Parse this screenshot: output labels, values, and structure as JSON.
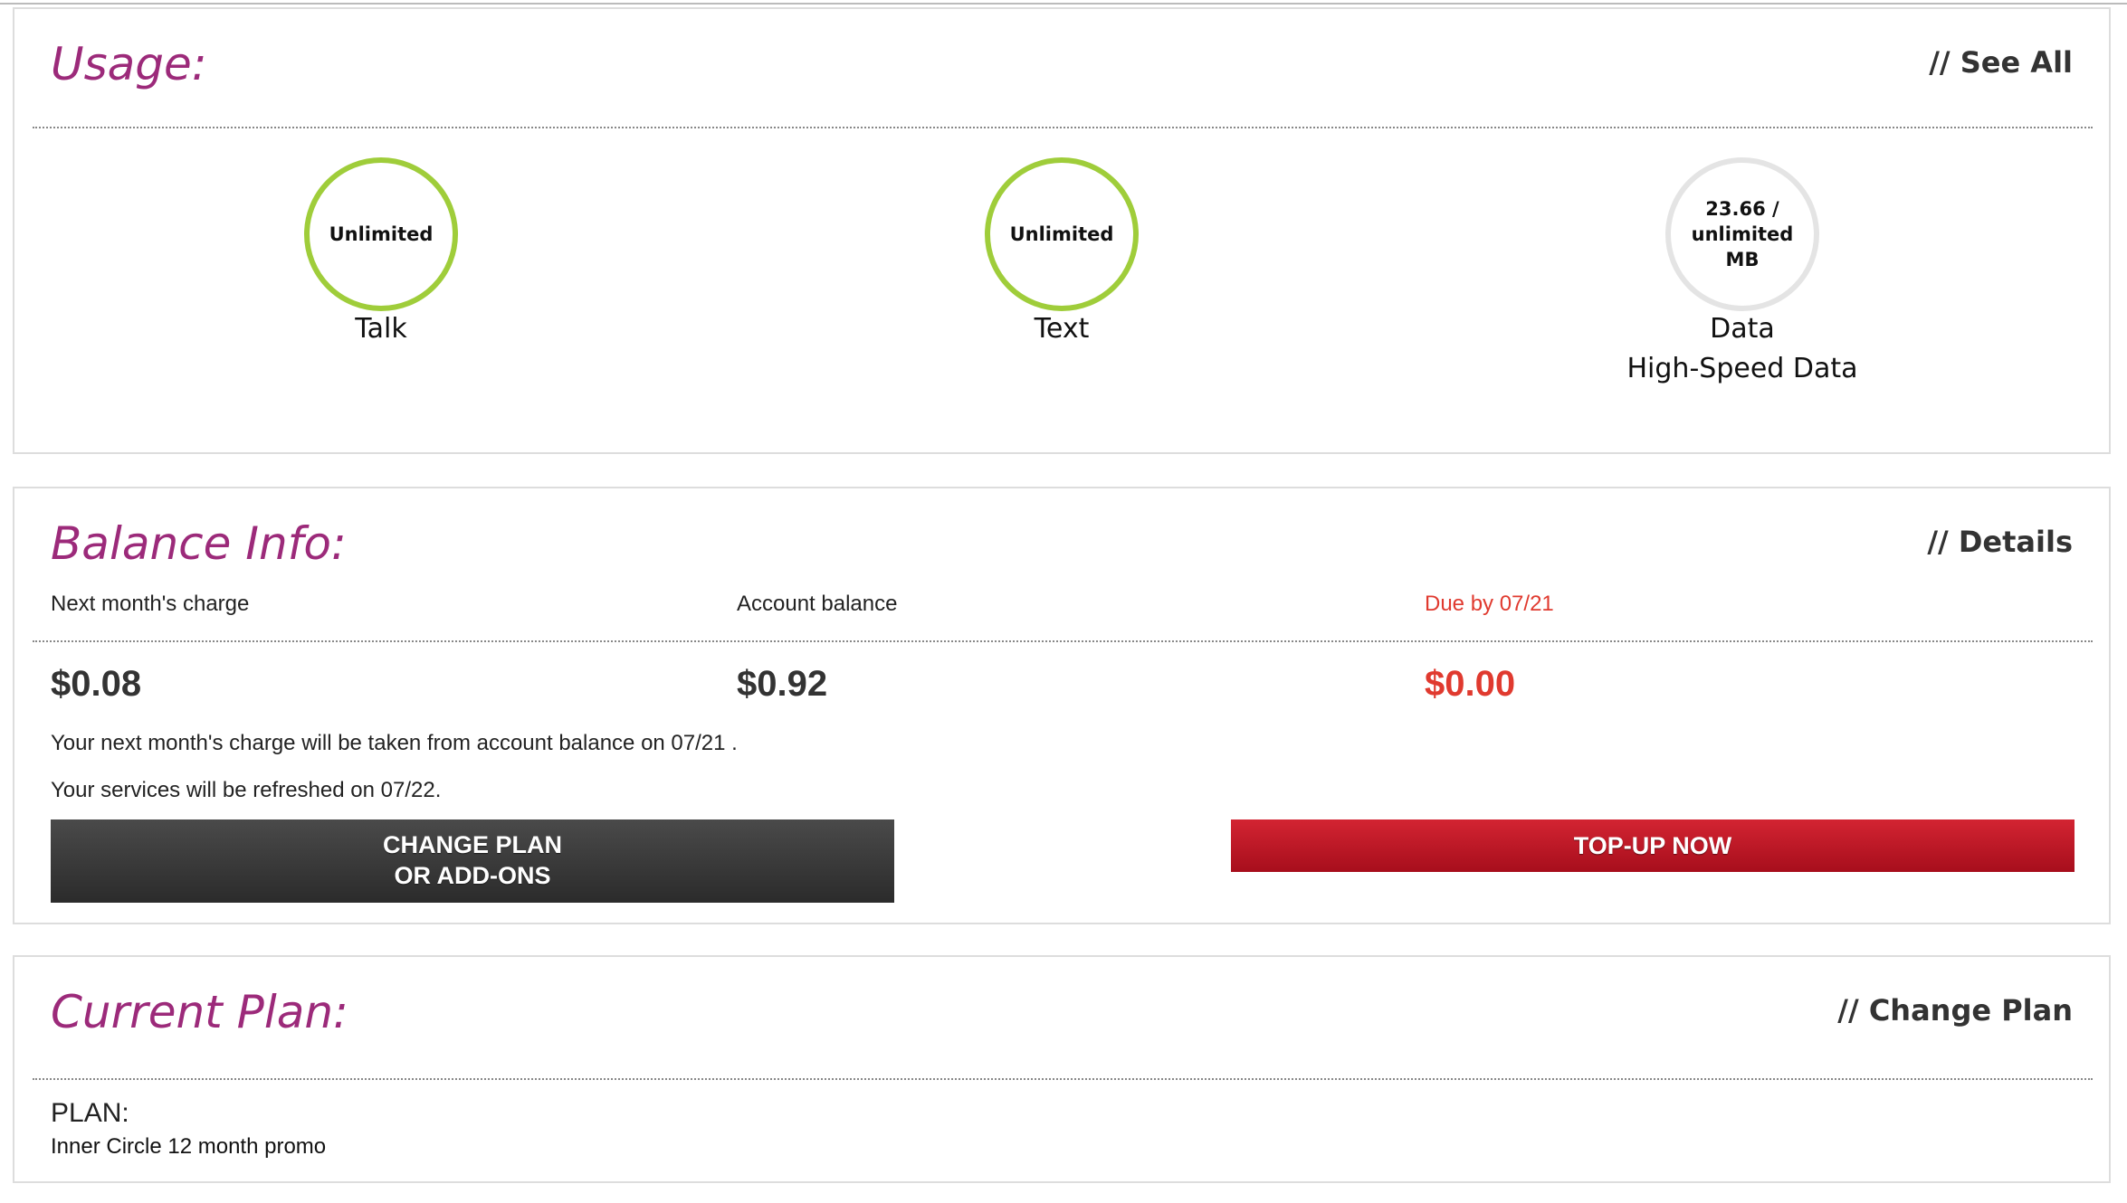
{
  "usage": {
    "title": "Usage:",
    "link": "// See All",
    "items": [
      {
        "value": "Unlimited",
        "label": "Talk",
        "sublabel": ""
      },
      {
        "value": "Unlimited",
        "label": "Text",
        "sublabel": ""
      },
      {
        "value_lines": [
          "23.66 /",
          "unlimited",
          "MB"
        ],
        "label": "Data",
        "sublabel": "High-Speed Data"
      }
    ]
  },
  "balance": {
    "title": "Balance Info:",
    "link": "// Details",
    "columns": [
      {
        "label": "Next month's charge",
        "value": "$0.08"
      },
      {
        "label": "Account balance",
        "value": "$0.92"
      },
      {
        "label": "Due by 07/21",
        "value": "$0.00"
      }
    ],
    "note1": "Your next month's charge will be taken from account balance on 07/21 .",
    "note2": "Your services will be refreshed on 07/22.",
    "change_button_lines": [
      "CHANGE PLAN",
      "OR ADD-ONS"
    ],
    "topup_button": "TOP-UP NOW"
  },
  "plan": {
    "title": "Current Plan:",
    "link": "// Change Plan",
    "label": "PLAN:",
    "value": "Inner Circle 12 month promo"
  },
  "colors": {
    "title": "#9c2a7a",
    "gauge_full": "#9fcd3a",
    "gauge_empty": "#e4e4e4",
    "due": "#e03a2f",
    "topup": "#c31a28",
    "change": "#3a3a3a"
  }
}
